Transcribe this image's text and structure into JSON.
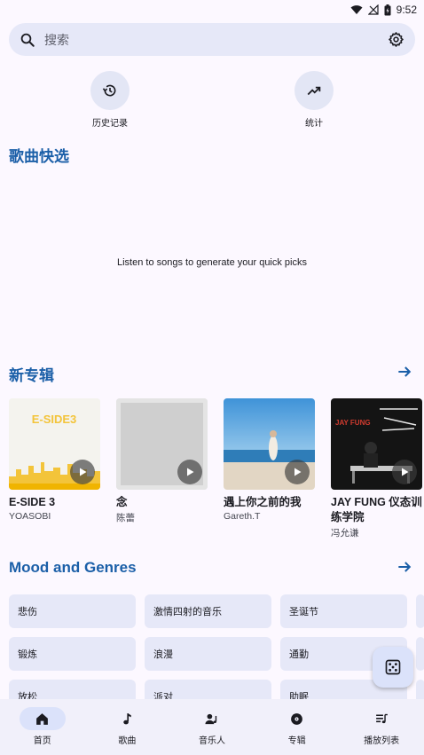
{
  "status": {
    "time": "9:52"
  },
  "search": {
    "placeholder": "搜索"
  },
  "quick_actions": [
    {
      "label": "历史记录",
      "icon": "history-icon"
    },
    {
      "label": "统计",
      "icon": "trending-up-icon"
    }
  ],
  "quick_picks": {
    "title": "歌曲快选",
    "empty_message": "Listen to songs to generate your quick picks"
  },
  "new_albums": {
    "title": "新专辑",
    "items": [
      {
        "title": "E-SIDE 3",
        "artist": "YOASOBI",
        "cover_text": "E-SIDE3"
      },
      {
        "title": "念",
        "artist": "陈蕾"
      },
      {
        "title": "遇上你之前的我",
        "artist": "Gareth.T"
      },
      {
        "title": "JAY FUNG 仪态训练学院",
        "artist": "冯允谦",
        "cover_text": "JAY FUNG"
      }
    ]
  },
  "mood": {
    "title": "Mood and Genres",
    "rows": [
      [
        "悲伤",
        "激情四射的音乐",
        "圣诞节"
      ],
      [
        "锻炼",
        "浪漫",
        "通勤"
      ],
      [
        "放松",
        "派对",
        "助眠"
      ]
    ]
  },
  "nav": {
    "items": [
      {
        "label": "首页",
        "icon": "home-icon"
      },
      {
        "label": "歌曲",
        "icon": "music-note-icon"
      },
      {
        "label": "音乐人",
        "icon": "artist-icon"
      },
      {
        "label": "专辑",
        "icon": "album-icon"
      },
      {
        "label": "播放列表",
        "icon": "playlist-icon"
      }
    ],
    "active": "首页"
  },
  "colors": {
    "accent": "#1b5fa8",
    "surface": "#e6e8f8",
    "background": "#fcf8ff"
  }
}
